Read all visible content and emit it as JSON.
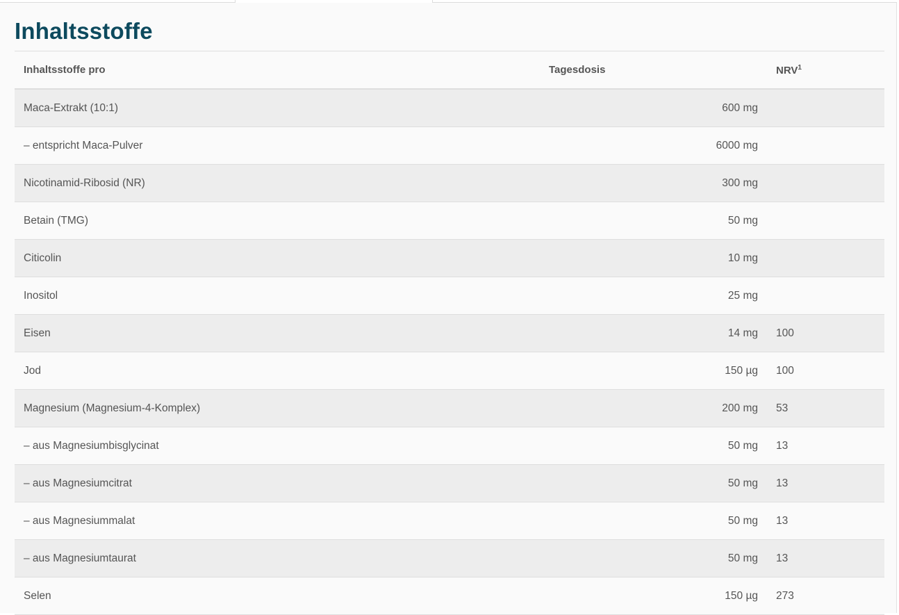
{
  "title": "Inhaltsstoffe",
  "table": {
    "headers": {
      "name": "Inhaltsstoffe pro",
      "dose": "Tagesdosis",
      "nrv": "NRV",
      "nrv_sup": "1"
    },
    "rows": [
      {
        "name": "Maca-Extrakt (10:1)",
        "dose": "600 mg",
        "nrv": ""
      },
      {
        "name": "– entspricht Maca-Pulver",
        "dose": "6000 mg",
        "nrv": ""
      },
      {
        "name": "Nicotinamid-Ribosid (NR)",
        "dose": "300 mg",
        "nrv": ""
      },
      {
        "name": "Betain (TMG)",
        "dose": "50 mg",
        "nrv": ""
      },
      {
        "name": "Citicolin",
        "dose": "10 mg",
        "nrv": ""
      },
      {
        "name": "Inositol",
        "dose": "25 mg",
        "nrv": ""
      },
      {
        "name": "Eisen",
        "dose": "14 mg",
        "nrv": "100"
      },
      {
        "name": "Jod",
        "dose": "150 µg",
        "nrv": "100"
      },
      {
        "name": "Magnesium (Magnesium-4-Komplex)",
        "dose": "200 mg",
        "nrv": "53"
      },
      {
        "name": "– aus Magnesiumbisglycinat",
        "dose": "50 mg",
        "nrv": "13"
      },
      {
        "name": "– aus Magnesiumcitrat",
        "dose": "50 mg",
        "nrv": "13"
      },
      {
        "name": "– aus Magnesiummalat",
        "dose": "50 mg",
        "nrv": "13"
      },
      {
        "name": "– aus Magnesiumtaurat",
        "dose": "50 mg",
        "nrv": "13"
      },
      {
        "name": "Selen",
        "dose": "150 µg",
        "nrv": "273"
      }
    ]
  },
  "colors": {
    "title": "#0d4a5e",
    "text": "#555555",
    "row_shaded": "#ededed",
    "row_plain": "#fafafa",
    "border": "#dedede"
  }
}
